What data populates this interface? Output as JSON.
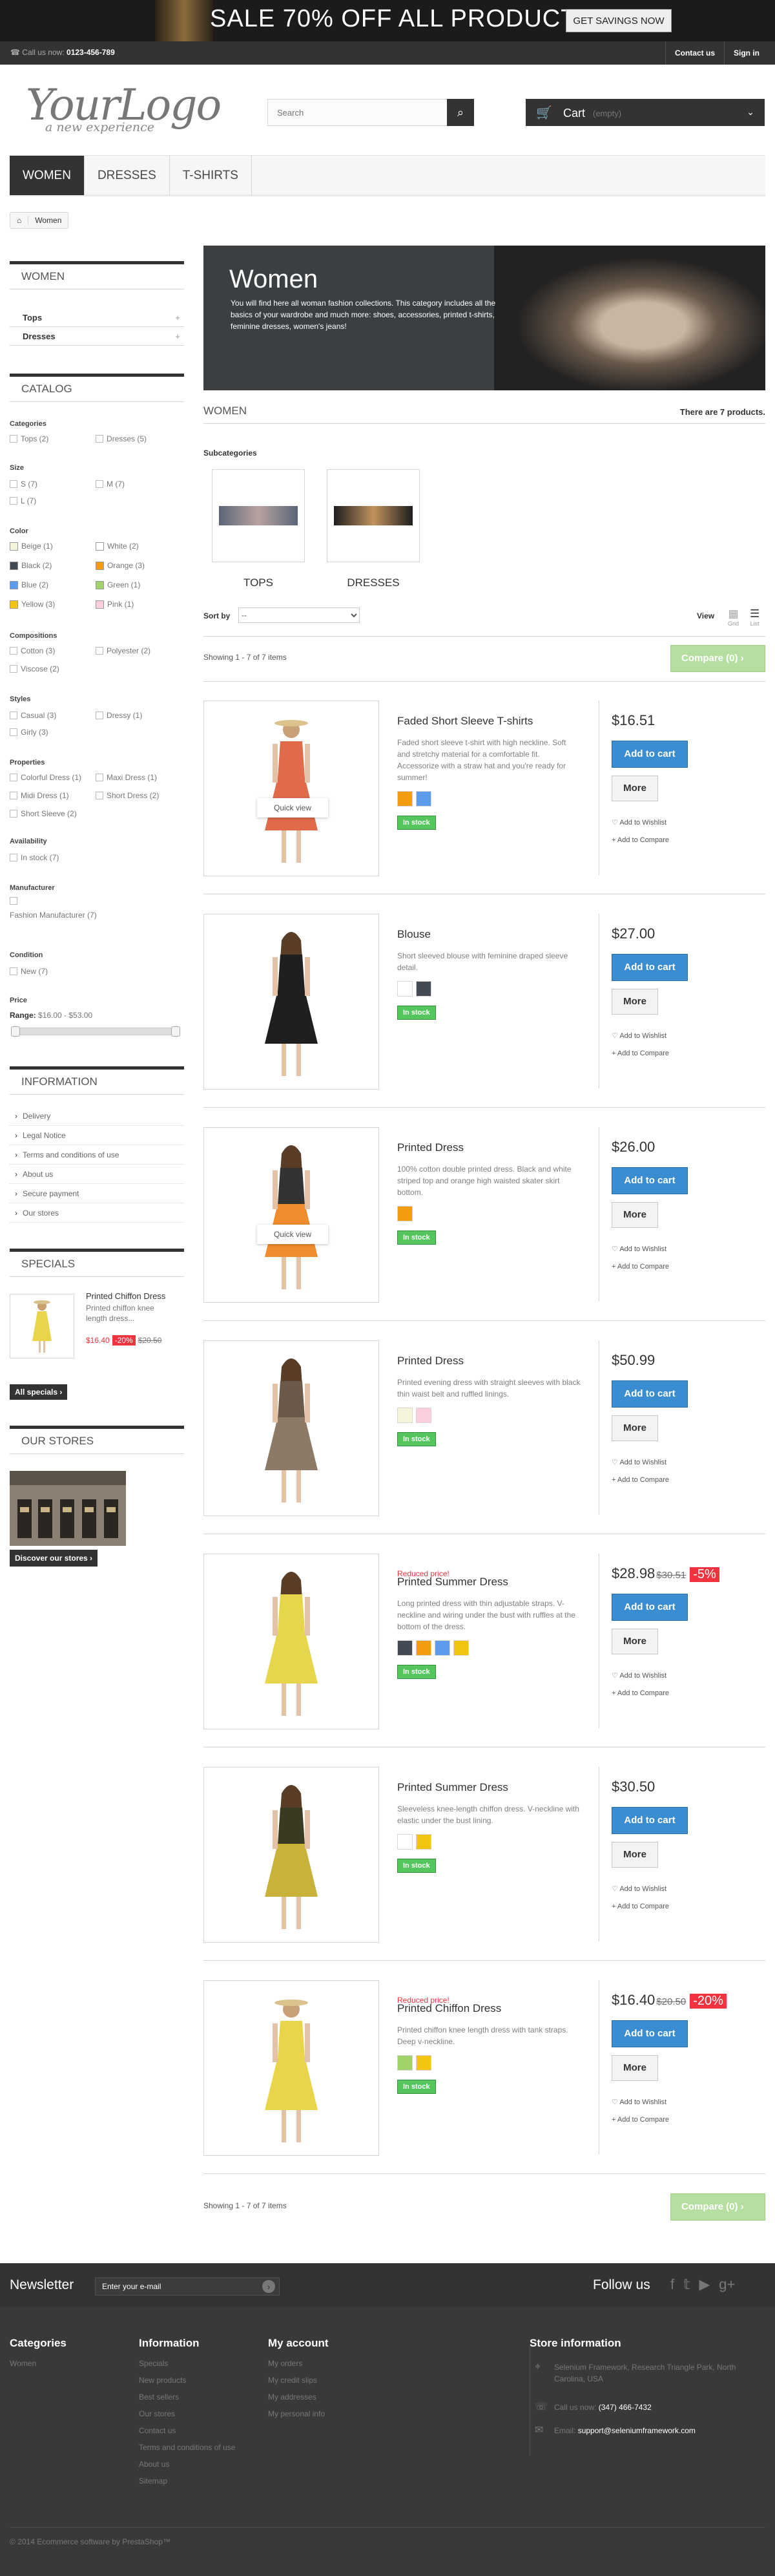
{
  "banner": {
    "text": "SALE 70% OFF ALL PRODUCTS",
    "button": "GET SAVINGS NOW"
  },
  "topnav": {
    "call_label": "Call us now:",
    "phone": "0123-456-789",
    "contact": "Contact us",
    "signin": "Sign in"
  },
  "logo": {
    "main": "YourLogo",
    "tagline": "a new experience"
  },
  "search": {
    "placeholder": "Search"
  },
  "cart": {
    "label": "Cart",
    "state": "(empty)"
  },
  "menu": [
    "WOMEN",
    "DRESSES",
    "T-SHIRTS"
  ],
  "breadcrumb": {
    "current": "Women"
  },
  "sidebar": {
    "women_title": "WOMEN",
    "categories": [
      "Tops",
      "Dresses"
    ],
    "catalog_title": "CATALOG",
    "filters": {
      "categories_label": "Categories",
      "tops": "Tops (2)",
      "dresses": "Dresses (5)",
      "size_label": "Size",
      "s": "S (7)",
      "m": "M (7)",
      "l": "L (7)",
      "color_label": "Color",
      "colors": [
        {
          "label": "Beige (1)",
          "hex": "#f5f5dc"
        },
        {
          "label": "White (2)",
          "hex": "#ffffff"
        },
        {
          "label": "Black (2)",
          "hex": "#434a54"
        },
        {
          "label": "Orange (3)",
          "hex": "#f39c11"
        },
        {
          "label": "Blue (2)",
          "hex": "#5d9cec"
        },
        {
          "label": "Green (1)",
          "hex": "#a0d468"
        },
        {
          "label": "Yellow (3)",
          "hex": "#f1c40f"
        },
        {
          "label": "Pink (1)",
          "hex": "#fcccdf"
        }
      ],
      "compositions_label": "Compositions",
      "cotton": "Cotton (3)",
      "polyester": "Polyester (2)",
      "viscose": "Viscose (2)",
      "styles_label": "Styles",
      "casual": "Casual (3)",
      "dressy": "Dressy (1)",
      "girly": "Girly (3)",
      "properties_label": "Properties",
      "colorful": "Colorful Dress (1)",
      "maxi": "Maxi Dress (1)",
      "midi": "Midi Dress (1)",
      "short_dress": "Short Dress (2)",
      "short_sleeve": "Short Sleeve (2)",
      "availability_label": "Availability",
      "in_stock": "In stock (7)",
      "manufacturer_label": "Manufacturer",
      "manufacturer": "Fashion Manufacturer (7)",
      "condition_label": "Condition",
      "new": "New (7)",
      "price_label": "Price",
      "range_label": "Range:",
      "range": "$16.00 - $53.00"
    },
    "info_title": "INFORMATION",
    "info_links": [
      "Delivery",
      "Legal Notice",
      "Terms and conditions of use",
      "About us",
      "Secure payment",
      "Our stores"
    ],
    "specials_title": "SPECIALS",
    "special": {
      "name": "Printed Chiffon Dress",
      "desc": "Printed chiffon knee length dress...",
      "price": "$16.40",
      "discount": "-20%",
      "old": "$20.50"
    },
    "all_specials": "All specials",
    "stores_title": "OUR STORES",
    "discover": "Discover our stores"
  },
  "category": {
    "title": "Women",
    "desc": "You will find here all woman fashion collections. This category includes all the basics of your wardrobe and much more: shoes, accessories, printed t-shirts, feminine dresses, women's jeans!"
  },
  "heading": {
    "title": "WOMEN",
    "count": "There are 7 products."
  },
  "subcategories": {
    "label": "Subcategories",
    "items": [
      "TOPS",
      "DRESSES"
    ]
  },
  "sort": {
    "label": "Sort by",
    "selected": "--",
    "view": "View",
    "grid": "Grid",
    "list": "List"
  },
  "showing": "Showing 1 - 7 of 7 items",
  "compare": "Compare (0)",
  "products": [
    {
      "reduced": "",
      "name": "Faded Short Sleeve T-shirts",
      "desc": "Faded short sleeve t-shirt with high neckline. Soft and stretchy material for a comfortable fit. Accessorize with a straw hat and you're ready for summer!",
      "colors": [
        "#f39c11",
        "#5d9cec"
      ],
      "stock": "In stock",
      "price": "$16.51",
      "old": "",
      "discount": "",
      "quickview": "Quick view"
    },
    {
      "reduced": "",
      "name": "Blouse",
      "desc": "Short sleeved blouse with feminine draped sleeve detail.",
      "colors": [
        "#ffffff",
        "#434a54"
      ],
      "stock": "In stock",
      "price": "$27.00",
      "old": "",
      "discount": "",
      "quickview": ""
    },
    {
      "reduced": "",
      "name": "Printed Dress",
      "desc": "100% cotton double printed dress. Black and white striped top and orange high waisted skater skirt bottom.",
      "colors": [
        "#f39c11"
      ],
      "stock": "In stock",
      "price": "$26.00",
      "old": "",
      "discount": "",
      "quickview": "Quick view"
    },
    {
      "reduced": "",
      "name": "Printed Dress",
      "desc": "Printed evening dress with straight sleeves with black thin waist belt and ruffled linings.",
      "colors": [
        "#f5f5dc",
        "#fcccdf"
      ],
      "stock": "In stock",
      "price": "$50.99",
      "old": "",
      "discount": "",
      "quickview": ""
    },
    {
      "reduced": "Reduced price!",
      "name": "Printed Summer Dress",
      "desc": "Long printed dress with thin adjustable straps. V-neckline and wiring under the bust with ruffles at the bottom of the dress.",
      "colors": [
        "#434a54",
        "#f39c11",
        "#5d9cec",
        "#f1c40f"
      ],
      "stock": "In stock",
      "price": "$28.98",
      "old": "$30.51",
      "discount": "-5%",
      "quickview": ""
    },
    {
      "reduced": "",
      "name": "Printed Summer Dress",
      "desc": "Sleeveless knee-length chiffon dress. V-neckline with elastic under the bust lining.",
      "colors": [
        "#ffffff",
        "#f1c40f"
      ],
      "stock": "In stock",
      "price": "$30.50",
      "old": "",
      "discount": "",
      "quickview": ""
    },
    {
      "reduced": "Reduced price!",
      "name": "Printed Chiffon Dress",
      "desc": "Printed chiffon knee length dress with tank straps. Deep v-neckline.",
      "colors": [
        "#a0d468",
        "#f1c40f"
      ],
      "stock": "In stock",
      "price": "$16.40",
      "old": "$20.50",
      "discount": "-20%",
      "quickview": ""
    }
  ],
  "product_actions": {
    "add": "Add to cart",
    "more": "More",
    "wishlist": "Add to Wishlist",
    "compare": "Add to Compare"
  },
  "newsletter": {
    "title": "Newsletter",
    "placeholder": "Enter your e-mail",
    "follow": "Follow us"
  },
  "footer": {
    "categories_title": "Categories",
    "categories": [
      "Women"
    ],
    "information_title": "Information",
    "information": [
      "Specials",
      "New products",
      "Best sellers",
      "Our stores",
      "Contact us",
      "Terms and conditions of use",
      "About us",
      "Sitemap"
    ],
    "account_title": "My account",
    "account": [
      "My orders",
      "My credit slips",
      "My addresses",
      "My personal info"
    ],
    "store_title": "Store information",
    "address": "Selenium Framework, Research Triangle Park, North Carolina, USA",
    "call_label": "Call us now:",
    "phone": "(347) 466-7432",
    "email_label": "Email:",
    "email": "support@seleniumframework.com",
    "copyright": "© 2014 Ecommerce software by PrestaShop™"
  }
}
